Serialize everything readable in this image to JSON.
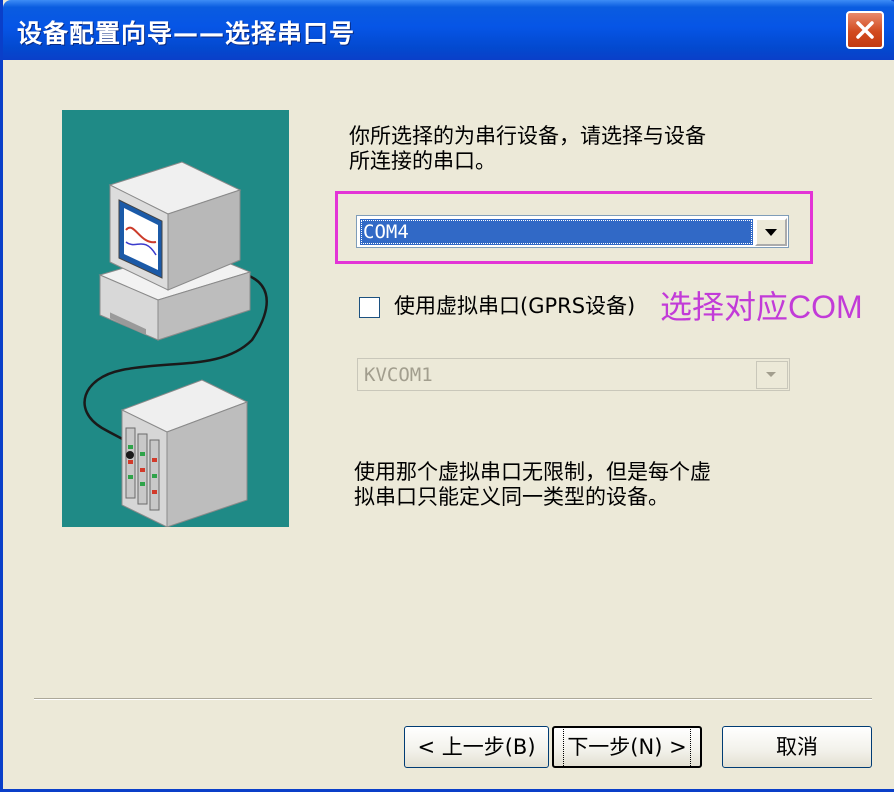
{
  "window": {
    "title": "设备配置向导——选择串口号"
  },
  "main": {
    "instruction": [
      "你所选择的为串行设备，请选择与设备",
      "所连接的串口。"
    ],
    "port_select": {
      "value": "COM4"
    },
    "virtual_port_checkbox": {
      "label": "使用虚拟串口(GPRS设备)",
      "checked": false
    },
    "annotation": "选择对应COM",
    "virtual_port_select": {
      "value": "KVCOM1",
      "enabled": false
    },
    "note": [
      "使用那个虚拟串口无限制，但是每个虚",
      "拟串口只能定义同一类型的设备。"
    ]
  },
  "footer": {
    "back_label": "< 上一步(B)",
    "next_label": "下一步(N) >",
    "cancel_label": "取消"
  },
  "colors": {
    "title_bar": "#0655e6",
    "close_button": "#d24b1f",
    "dialog_background": "#ece9d8",
    "selection": "#3169c6",
    "highlight_box": "#e334d6",
    "annotation": "#c23bd8",
    "illustration_background": "#1f8a86"
  },
  "icons": [
    "close-icon",
    "dropdown-arrow-icon",
    "computer-device-illustration"
  ]
}
